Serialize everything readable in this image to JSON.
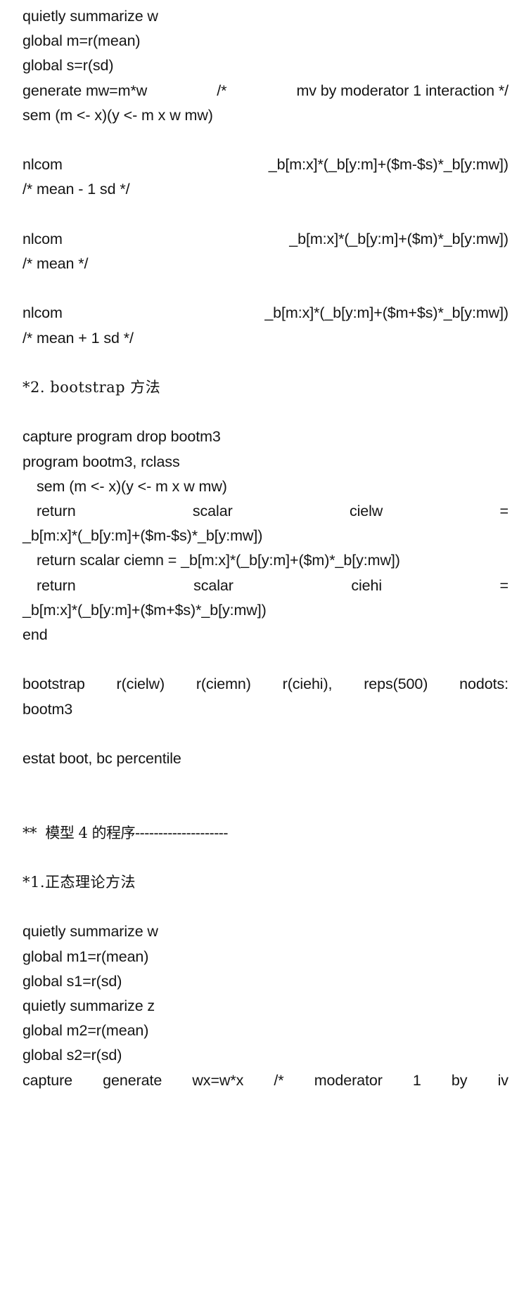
{
  "document": {
    "type": "stata-code-listing",
    "background_color": "#ffffff",
    "text_color": "#141414",
    "blocks": [
      {
        "id": "model3-normal-theory",
        "lines": [
          {
            "kind": "plain",
            "text": "quietly summarize w"
          },
          {
            "kind": "plain",
            "text": "global m=r(mean)"
          },
          {
            "kind": "plain",
            "text": "global s=r(sd)"
          },
          {
            "kind": "justify",
            "segments": [
              "generate mw=m*w",
              "/*",
              "mv by moderator 1 interaction */"
            ]
          },
          {
            "kind": "plain",
            "text": "sem (m <- x)(y <- m x w mw)"
          },
          {
            "kind": "blank",
            "text": ""
          },
          {
            "kind": "justify",
            "segments": [
              "nlcom",
              "_b[m:x]*(_b[y:m]+($m-$s)*_b[y:mw])"
            ]
          },
          {
            "kind": "plain",
            "text": "/* mean - 1 sd */"
          },
          {
            "kind": "blank",
            "text": ""
          },
          {
            "kind": "justify",
            "segments": [
              "nlcom",
              "_b[m:x]*(_b[y:m]+($m)*_b[y:mw])"
            ]
          },
          {
            "kind": "plain",
            "text": "/* mean */"
          },
          {
            "kind": "blank",
            "text": ""
          },
          {
            "kind": "justify",
            "segments": [
              "nlcom",
              "_b[m:x]*(_b[y:m]+($m+$s)*_b[y:mw])"
            ]
          },
          {
            "kind": "plain",
            "text": "/* mean + 1 sd */"
          },
          {
            "kind": "blank",
            "text": ""
          }
        ]
      },
      {
        "id": "model3-bootstrap",
        "heading": "*2. bootstrap 方法",
        "lines": [
          {
            "kind": "heading-cn",
            "text": "*2. bootstrap 方法"
          },
          {
            "kind": "blank",
            "text": ""
          },
          {
            "kind": "plain",
            "text": "capture program drop bootm3"
          },
          {
            "kind": "plain",
            "text": "program bootm3, rclass"
          },
          {
            "kind": "indent",
            "text": "sem (m <- x)(y <- m x w mw)"
          },
          {
            "kind": "justify-indent",
            "segments": [
              "return",
              "scalar",
              "cielw",
              "="
            ]
          },
          {
            "kind": "plain",
            "text": "_b[m:x]*(_b[y:m]+($m-$s)*_b[y:mw])"
          },
          {
            "kind": "indent",
            "text": "return scalar ciemn = _b[m:x]*(_b[y:m]+($m)*_b[y:mw])"
          },
          {
            "kind": "justify-indent",
            "segments": [
              "return",
              "scalar",
              "ciehi",
              "="
            ]
          },
          {
            "kind": "plain",
            "text": "_b[m:x]*(_b[y:m]+($m+$s)*_b[y:mw])"
          },
          {
            "kind": "plain",
            "text": "end"
          },
          {
            "kind": "blank",
            "text": ""
          },
          {
            "kind": "justify",
            "segments": [
              "bootstrap",
              "r(cielw)",
              "r(ciemn)",
              "r(ciehi),",
              "reps(500)",
              "nodots:"
            ]
          },
          {
            "kind": "plain",
            "text": "bootm3"
          },
          {
            "kind": "blank",
            "text": ""
          },
          {
            "kind": "plain",
            "text": "estat boot, bc percentile"
          },
          {
            "kind": "blank",
            "text": ""
          },
          {
            "kind": "blank",
            "text": ""
          }
        ]
      },
      {
        "id": "model4-section",
        "lines": [
          {
            "kind": "heading-cn",
            "text": "**  模型 4 的程序--------------------"
          },
          {
            "kind": "blank",
            "text": ""
          },
          {
            "kind": "heading-cn",
            "text": "*1.正态理论方法"
          },
          {
            "kind": "blank",
            "text": ""
          },
          {
            "kind": "plain",
            "text": "quietly summarize w"
          },
          {
            "kind": "plain",
            "text": "global m1=r(mean)"
          },
          {
            "kind": "plain",
            "text": "global s1=r(sd)"
          },
          {
            "kind": "plain",
            "text": "quietly summarize z"
          },
          {
            "kind": "plain",
            "text": "global m2=r(mean)"
          },
          {
            "kind": "plain",
            "text": "global s2=r(sd)"
          },
          {
            "kind": "justify",
            "segments": [
              "capture",
              "generate",
              "wx=w*x",
              "/*",
              "moderator",
              "1",
              "by",
              "iv"
            ]
          }
        ]
      }
    ]
  },
  "lines_flat": {
    "l01": "quietly summarize w",
    "l02": "global m=r(mean)",
    "l03": "global s=r(sd)",
    "l04a": "generate mw=m*w",
    "l04b": "/*",
    "l04c": "mv by moderator 1 interaction */",
    "l05": "sem (m <- x)(y <- m x w mw)",
    "l06a": "nlcom",
    "l06b": "_b[m:x]*(_b[y:m]+($m-$s)*_b[y:mw])",
    "l07": "/* mean - 1 sd */",
    "l08a": "nlcom",
    "l08b": "_b[m:x]*(_b[y:m]+($m)*_b[y:mw])",
    "l09": "/* mean */",
    "l10a": "nlcom",
    "l10b": "_b[m:x]*(_b[y:m]+($m+$s)*_b[y:mw])",
    "l11": "/* mean + 1 sd */",
    "l12": "*2. bootstrap 方法",
    "l13": "capture program drop bootm3",
    "l14": "program bootm3, rclass",
    "l15": "sem (m <- x)(y <- m x w mw)",
    "l16a": "return",
    "l16b": "scalar",
    "l16c": "cielw",
    "l16d": "=",
    "l17": "_b[m:x]*(_b[y:m]+($m-$s)*_b[y:mw])",
    "l18": "return scalar ciemn = _b[m:x]*(_b[y:m]+($m)*_b[y:mw])",
    "l19a": "return",
    "l19b": "scalar",
    "l19c": "ciehi",
    "l19d": "=",
    "l20": "_b[m:x]*(_b[y:m]+($m+$s)*_b[y:mw])",
    "l21": "end",
    "l22a": "bootstrap",
    "l22b": "r(cielw)",
    "l22c": "r(ciemn)",
    "l22d": "r(ciehi),",
    "l22e": "reps(500)",
    "l22f": "nodots:",
    "l23": "bootm3",
    "l24": "estat boot, bc percentile",
    "l25": "**  模型 4 的程序--------------------",
    "l26": "*1.正态理论方法",
    "l27": "quietly summarize w",
    "l28": "global m1=r(mean)",
    "l29": "global s1=r(sd)",
    "l30": "quietly summarize z",
    "l31": "global m2=r(mean)",
    "l32": "global s2=r(sd)",
    "l33a": "capture",
    "l33b": "generate",
    "l33c": "wx=w*x",
    "l33d": "/*",
    "l33e": "moderator",
    "l33f": "1",
    "l33g": "by",
    "l33h": "iv"
  }
}
